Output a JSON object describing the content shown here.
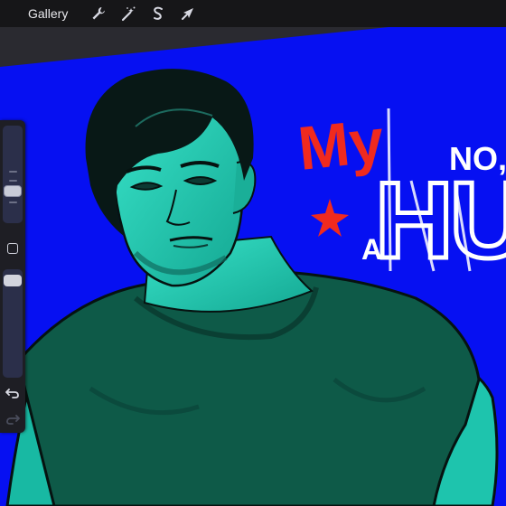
{
  "topbar": {
    "gallery_label": "Gallery",
    "tools": [
      {
        "name": "actions",
        "icon": "wrench-icon"
      },
      {
        "name": "adjustments",
        "icon": "magic-wand-icon"
      },
      {
        "name": "selection",
        "icon": "selection-s-icon"
      },
      {
        "name": "transform",
        "icon": "arrow-cursor-icon"
      }
    ]
  },
  "sidebar": {
    "brush_size_slider": "brush-size-slider",
    "modify_button": "square-icon",
    "opacity_slider": "opacity-slider",
    "undo_icon": "undo-arrow-icon",
    "redo_icon": "redo-arrow-icon"
  },
  "artwork": {
    "text_my": "My",
    "text_no": "NO,",
    "text_a": "A",
    "text_hu": "HU",
    "colors": {
      "background": "#0610f2",
      "skin": "#1fd2b8",
      "shirt": "#0e5a48",
      "hair": "#081816",
      "red_text": "#f02a1e",
      "white_text": "#ffffff"
    }
  }
}
